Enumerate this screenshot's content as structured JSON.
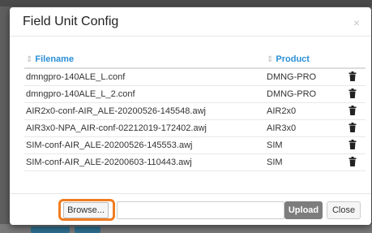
{
  "modal": {
    "title": "Field Unit Config",
    "close_glyph": "×"
  },
  "table": {
    "columns": [
      {
        "label": "Filename",
        "sort_icon": "sort-icon"
      },
      {
        "label": "Product",
        "sort_icon": "sort-icon"
      }
    ],
    "rows": [
      {
        "filename": "dmngpro-140ALE_L.conf",
        "product": "DMNG-PRO",
        "action_icon": "trash-icon"
      },
      {
        "filename": "dmngpro-140ALE_L_2.conf",
        "product": "DMNG-PRO",
        "action_icon": "trash-icon"
      },
      {
        "filename": "AIR2x0-conf-AIR_ALE-20200526-145548.awj",
        "product": "AIR2x0",
        "action_icon": "trash-icon"
      },
      {
        "filename": "AIR3x0-NPA_AIR-conf-02212019-172402.awj",
        "product": "AIR3x0",
        "action_icon": "trash-icon"
      },
      {
        "filename": "SIM-conf-AIR_ALE-20200526-145553.awj",
        "product": "SIM",
        "action_icon": "trash-icon"
      },
      {
        "filename": "SIM-conf-AIR_ALE-20200603-110443.awj",
        "product": "SIM",
        "action_icon": "trash-icon"
      }
    ]
  },
  "footer": {
    "browse_label": "Browse...",
    "file_value": "",
    "upload_label": "Upload",
    "close_label": "Close",
    "highlight_color": "#f07d22"
  },
  "colors": {
    "header_link": "#2a8fd6",
    "upload_bg": "#7d7d7d"
  }
}
